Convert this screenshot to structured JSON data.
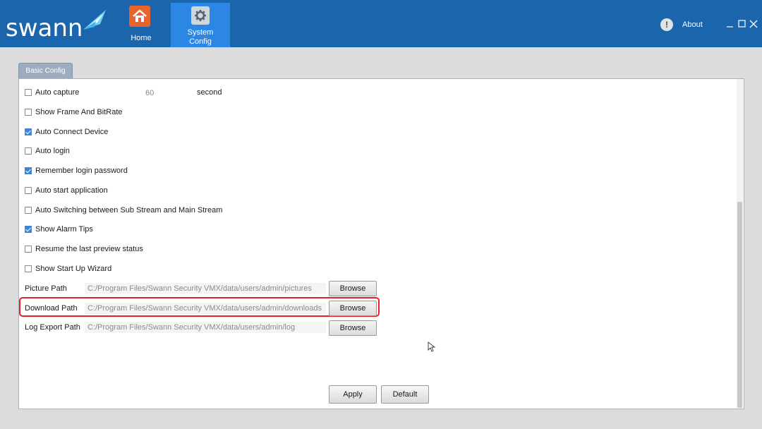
{
  "header": {
    "logo_text": "swann",
    "nav": [
      {
        "label": "Home",
        "icon": "home-icon",
        "color": "#e8642c"
      },
      {
        "label": "System\nConfig",
        "icon": "gear-icon",
        "active": true
      }
    ],
    "about_label": "About",
    "about_glyph": "!",
    "bg_color": "#1b65ad",
    "active_color": "#2b86e4"
  },
  "tab": {
    "label": "Basic Config"
  },
  "settings": {
    "auto_capture": {
      "label": "Auto capture",
      "checked": false,
      "value": "60",
      "unit": "second"
    },
    "checkboxes": [
      {
        "label": "Show Frame And BitRate",
        "checked": false
      },
      {
        "label": "Auto Connect Device",
        "checked": true
      },
      {
        "label": "Auto login",
        "checked": false
      },
      {
        "label": "Remember login password",
        "checked": true
      },
      {
        "label": "Auto start application",
        "checked": false
      },
      {
        "label": "Auto Switching between Sub Stream and Main Stream",
        "checked": false
      },
      {
        "label": "Show Alarm Tips",
        "checked": true
      },
      {
        "label": "Resume the last preview status",
        "checked": false
      },
      {
        "label": "Show Start Up Wizard",
        "checked": false
      }
    ],
    "paths": [
      {
        "label": "Picture Path",
        "value": "C:/Program Files/Swann Security VMX/data/users/admin/pictures",
        "button": "Browse"
      },
      {
        "label": "Download Path",
        "value": "C:/Program Files/Swann Security VMX/data/users/admin/downloads",
        "button": "Browse",
        "highlighted": true
      },
      {
        "label": "Log Export Path",
        "value": "C:/Program Files/Swann Security VMX/data/users/admin/log",
        "button": "Browse"
      }
    ]
  },
  "actions": {
    "apply": "Apply",
    "default": "Default"
  },
  "accent": {
    "check": "#3c84d6",
    "highlight": "#e8202a"
  }
}
